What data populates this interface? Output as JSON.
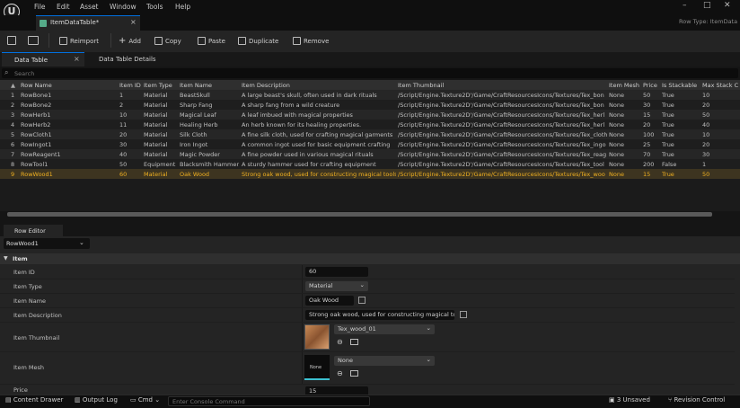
{
  "menubar": {
    "logo": "U",
    "items": [
      "File",
      "Edit",
      "Asset",
      "Window",
      "Tools",
      "Help"
    ]
  },
  "document_tab": {
    "title": "ItemDataTable*",
    "close": "×"
  },
  "row_type": "Row Type: ItemData",
  "toolbar": {
    "reimport": "Reimport",
    "add": "Add",
    "copy": "Copy",
    "paste": "Paste",
    "duplicate": "Duplicate",
    "remove": "Remove"
  },
  "subtabs": {
    "data_table": "Data Table",
    "details": "Data Table Details",
    "close": "×"
  },
  "search": {
    "placeholder": "Search"
  },
  "table": {
    "headers": [
      "Row Name",
      "Item ID",
      "Item Type",
      "Item Name",
      "Item Description",
      "Item Thumbnail",
      "Item Mesh",
      "Price",
      "Is Stackable",
      "Max Stack C"
    ],
    "rows": [
      [
        "1",
        "RowBone1",
        "1",
        "Material",
        "BeastSkull",
        "A large beast's skull, often used in dark rituals",
        "/Script/Engine.Texture2D'/Game/CraftResourcesIcons/Textures/Tex_bon",
        "None",
        "50",
        "True",
        "10"
      ],
      [
        "2",
        "RowBone2",
        "2",
        "Material",
        "Sharp Fang",
        "A sharp fang from a wild creature",
        "/Script/Engine.Texture2D'/Game/CraftResourcesIcons/Textures/Tex_bon",
        "None",
        "30",
        "True",
        "20"
      ],
      [
        "3",
        "RowHerb1",
        "10",
        "Material",
        "Magical Leaf",
        "A leaf imbued with magical properties",
        "/Script/Engine.Texture2D'/Game/CraftResourcesIcons/Textures/Tex_herl",
        "None",
        "15",
        "True",
        "50"
      ],
      [
        "4",
        "RowHerb2",
        "11",
        "Material",
        "Healing Herb",
        "An herb known for its healing properties.",
        "/Script/Engine.Texture2D'/Game/CraftResourcesIcons/Textures/Tex_herl",
        "None",
        "20",
        "True",
        "40"
      ],
      [
        "5",
        "RowCloth1",
        "20",
        "Material",
        "Silk Cloth",
        "A fine silk cloth, used for crafting magical garments",
        "/Script/Engine.Texture2D'/Game/CraftResourcesIcons/Textures/Tex_cloth",
        "None",
        "100",
        "True",
        "10"
      ],
      [
        "6",
        "RowIngot1",
        "30",
        "Material",
        "Iron Ingot",
        "A common ingot used for basic equipment crafting",
        "/Script/Engine.Texture2D'/Game/CraftResourcesIcons/Textures/Tex_ingo",
        "None",
        "25",
        "True",
        "20"
      ],
      [
        "7",
        "RowReagent1",
        "40",
        "Material",
        "Magic Powder",
        "A fine powder used in various magical rituals",
        "/Script/Engine.Texture2D'/Game/CraftResourcesIcons/Textures/Tex_reag",
        "None",
        "70",
        "True",
        "30"
      ],
      [
        "8",
        "RowTool1",
        "50",
        "Equipment",
        "Blacksmith Hammer",
        "A sturdy hammer used for crafting equipment",
        "/Script/Engine.Texture2D'/Game/CraftResourcesIcons/Textures/Tex_tool",
        "None",
        "200",
        "False",
        "1"
      ],
      [
        "9",
        "RowWood1",
        "60",
        "Material",
        "Oak Wood",
        "Strong oak wood, used for constructing magical tools",
        "/Script/Engine.Texture2D'/Game/CraftResourcesIcons/Textures/Tex_woo",
        "None",
        "15",
        "True",
        "50"
      ]
    ]
  },
  "row_editor": {
    "tab": "Row Editor",
    "selected_row": "RowWood1",
    "category": "Item",
    "fields": {
      "id_label": "Item ID",
      "id_value": "60",
      "type_label": "Item Type",
      "type_value": "Material",
      "name_label": "Item Name",
      "name_value": "Oak Wood",
      "desc_label": "Item Description",
      "desc_value": "Strong oak wood, used for constructing magical tools",
      "thumb_label": "Item Thumbnail",
      "thumb_value": "Tex_wood_01",
      "mesh_label": "Item Mesh",
      "mesh_value": "None",
      "mesh_thumb": "None",
      "price_label": "Price",
      "price_value": "15"
    }
  },
  "statusbar": {
    "content_drawer": "Content Drawer",
    "output_log": "Output Log",
    "cmd": "Cmd",
    "console_placeholder": "Enter Console Command",
    "unsaved": "3 Unsaved",
    "revision": "Revision Control"
  },
  "colors": {
    "accent": "#0070e0",
    "selected_row_text": "#f0b020",
    "selected_row_bg": "#3d3420"
  }
}
